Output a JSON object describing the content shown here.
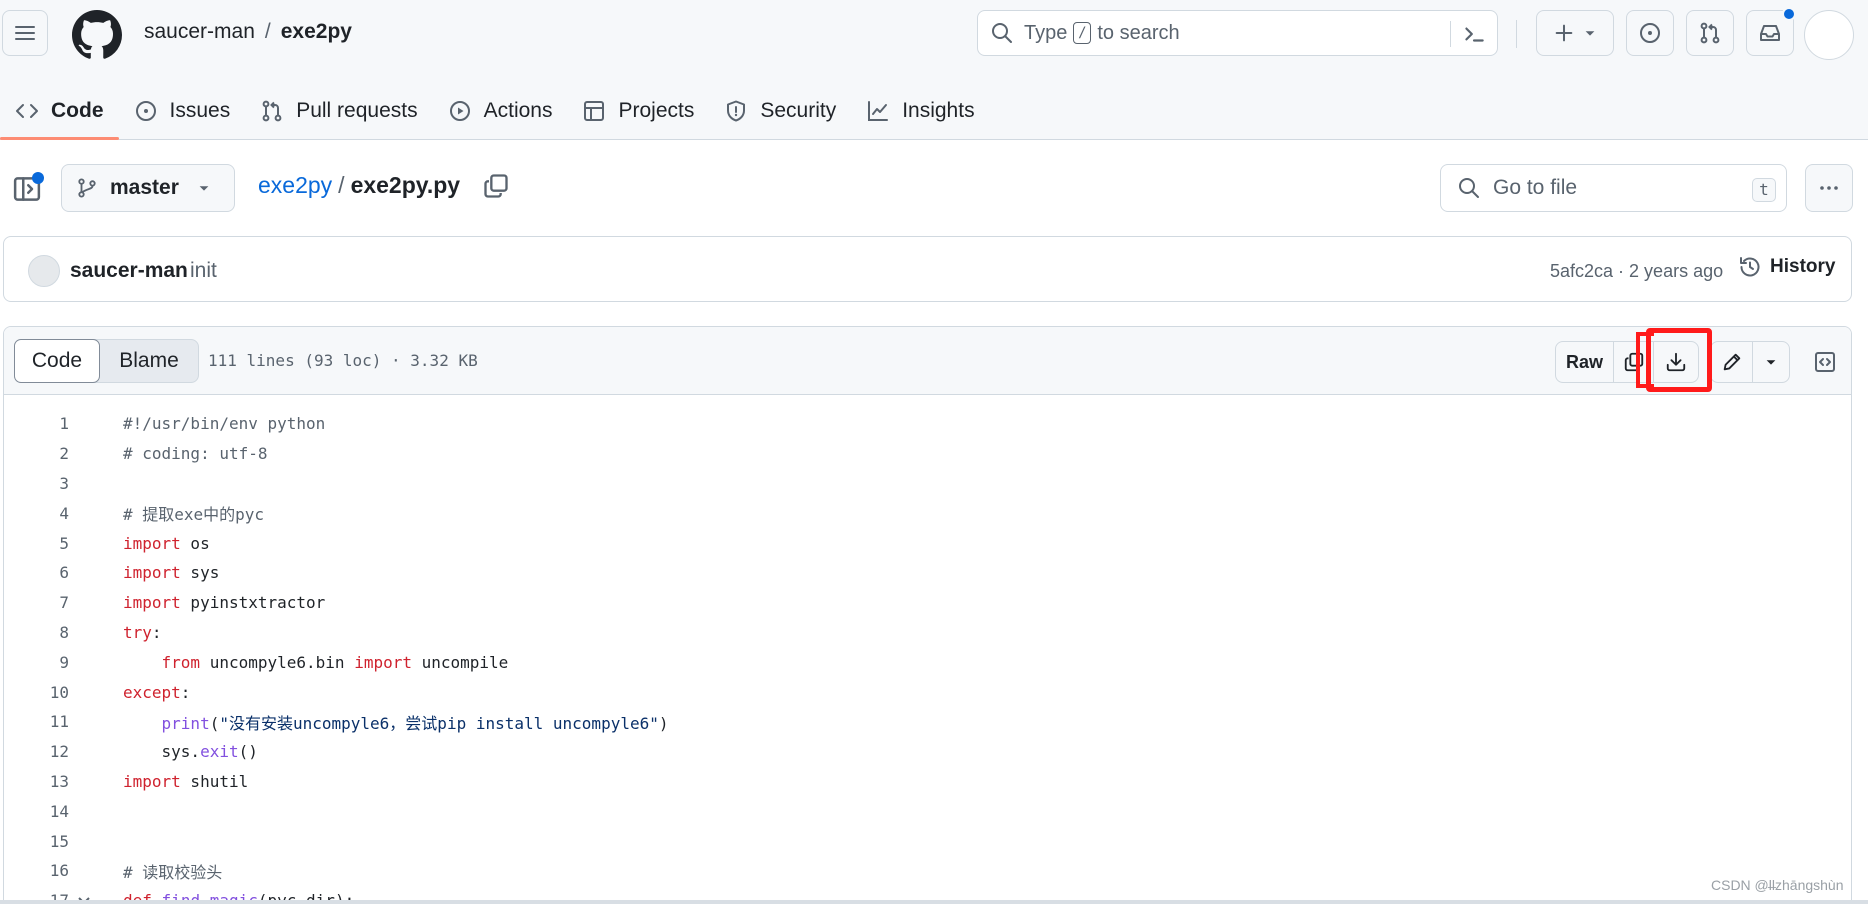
{
  "header": {
    "owner": "saucer-man",
    "separator": "/",
    "repo": "exe2py",
    "search_before": "Type",
    "search_key": "/",
    "search_after": "to search"
  },
  "nav": {
    "tabs": [
      {
        "label": "Code",
        "icon": "code-icon"
      },
      {
        "label": "Issues",
        "icon": "issue-opened-icon"
      },
      {
        "label": "Pull requests",
        "icon": "git-pull-request-icon"
      },
      {
        "label": "Actions",
        "icon": "play-icon"
      },
      {
        "label": "Projects",
        "icon": "table-icon"
      },
      {
        "label": "Security",
        "icon": "shield-icon"
      },
      {
        "label": "Insights",
        "icon": "graph-icon"
      }
    ],
    "selected": "Code"
  },
  "file_header": {
    "branch": "master",
    "repo_link": "exe2py",
    "separator": "/",
    "file_name": "exe2py.py",
    "goto_placeholder": "Go to file",
    "goto_key": "t"
  },
  "commit": {
    "author": "saucer-man",
    "message": "init",
    "meta": "5afc2ca · 2 years ago",
    "history_label": "History"
  },
  "viewer": {
    "tab_code": "Code",
    "tab_blame": "Blame",
    "file_info": "111 lines (93 loc) · 3.32 KB",
    "raw_label": "Raw"
  },
  "code_lines": [
    {
      "n": "1",
      "segs": [
        {
          "t": "#!/usr/bin/env python",
          "c": "cm"
        }
      ]
    },
    {
      "n": "2",
      "segs": [
        {
          "t": "# coding: utf-8",
          "c": "cm"
        }
      ]
    },
    {
      "n": "3",
      "segs": []
    },
    {
      "n": "4",
      "segs": [
        {
          "t": "# 提取exe中的pyc",
          "c": "cm"
        }
      ]
    },
    {
      "n": "5",
      "segs": [
        {
          "t": "import",
          "c": "kw"
        },
        {
          "t": " os",
          "c": ""
        }
      ]
    },
    {
      "n": "6",
      "segs": [
        {
          "t": "import",
          "c": "kw"
        },
        {
          "t": " sys",
          "c": ""
        }
      ]
    },
    {
      "n": "7",
      "segs": [
        {
          "t": "import",
          "c": "kw"
        },
        {
          "t": " pyinstxtractor",
          "c": ""
        }
      ]
    },
    {
      "n": "8",
      "segs": [
        {
          "t": "try",
          "c": "kw"
        },
        {
          "t": ":",
          "c": ""
        }
      ]
    },
    {
      "n": "9",
      "segs": [
        {
          "t": "    ",
          "c": ""
        },
        {
          "t": "from",
          "c": "kw"
        },
        {
          "t": " uncompyle6.bin ",
          "c": ""
        },
        {
          "t": "import",
          "c": "kw"
        },
        {
          "t": " uncompile",
          "c": ""
        }
      ]
    },
    {
      "n": "10",
      "segs": [
        {
          "t": "except",
          "c": "kw"
        },
        {
          "t": ":",
          "c": ""
        }
      ]
    },
    {
      "n": "11",
      "segs": [
        {
          "t": "    ",
          "c": ""
        },
        {
          "t": "print",
          "c": "fn"
        },
        {
          "t": "(",
          "c": ""
        },
        {
          "t": "\"没有安装uncompyle6，尝试pip install uncompyle6\"",
          "c": "str"
        },
        {
          "t": ")",
          "c": ""
        }
      ]
    },
    {
      "n": "12",
      "segs": [
        {
          "t": "    sys.",
          "c": ""
        },
        {
          "t": "exit",
          "c": "fn"
        },
        {
          "t": "()",
          "c": ""
        }
      ]
    },
    {
      "n": "13",
      "segs": [
        {
          "t": "import",
          "c": "kw"
        },
        {
          "t": " shutil",
          "c": ""
        }
      ]
    },
    {
      "n": "14",
      "segs": []
    },
    {
      "n": "15",
      "segs": []
    },
    {
      "n": "16",
      "segs": [
        {
          "t": "# 读取校验头",
          "c": "cm"
        }
      ]
    },
    {
      "n": "17",
      "segs": [
        {
          "t": "def",
          "c": "kw"
        },
        {
          "t": " ",
          "c": ""
        },
        {
          "t": "find_magic",
          "c": "fn"
        },
        {
          "t": "(pyc_dir):",
          "c": ""
        }
      ]
    }
  ],
  "watermark": "CSDN @l̶lzhāngshùn",
  "colors": {
    "accent": "#0969da",
    "tab_underline": "#fd8c73",
    "highlight": "#ff1a1a",
    "keyword": "#cf222e",
    "function": "#8250df",
    "string": "#0a3069"
  }
}
